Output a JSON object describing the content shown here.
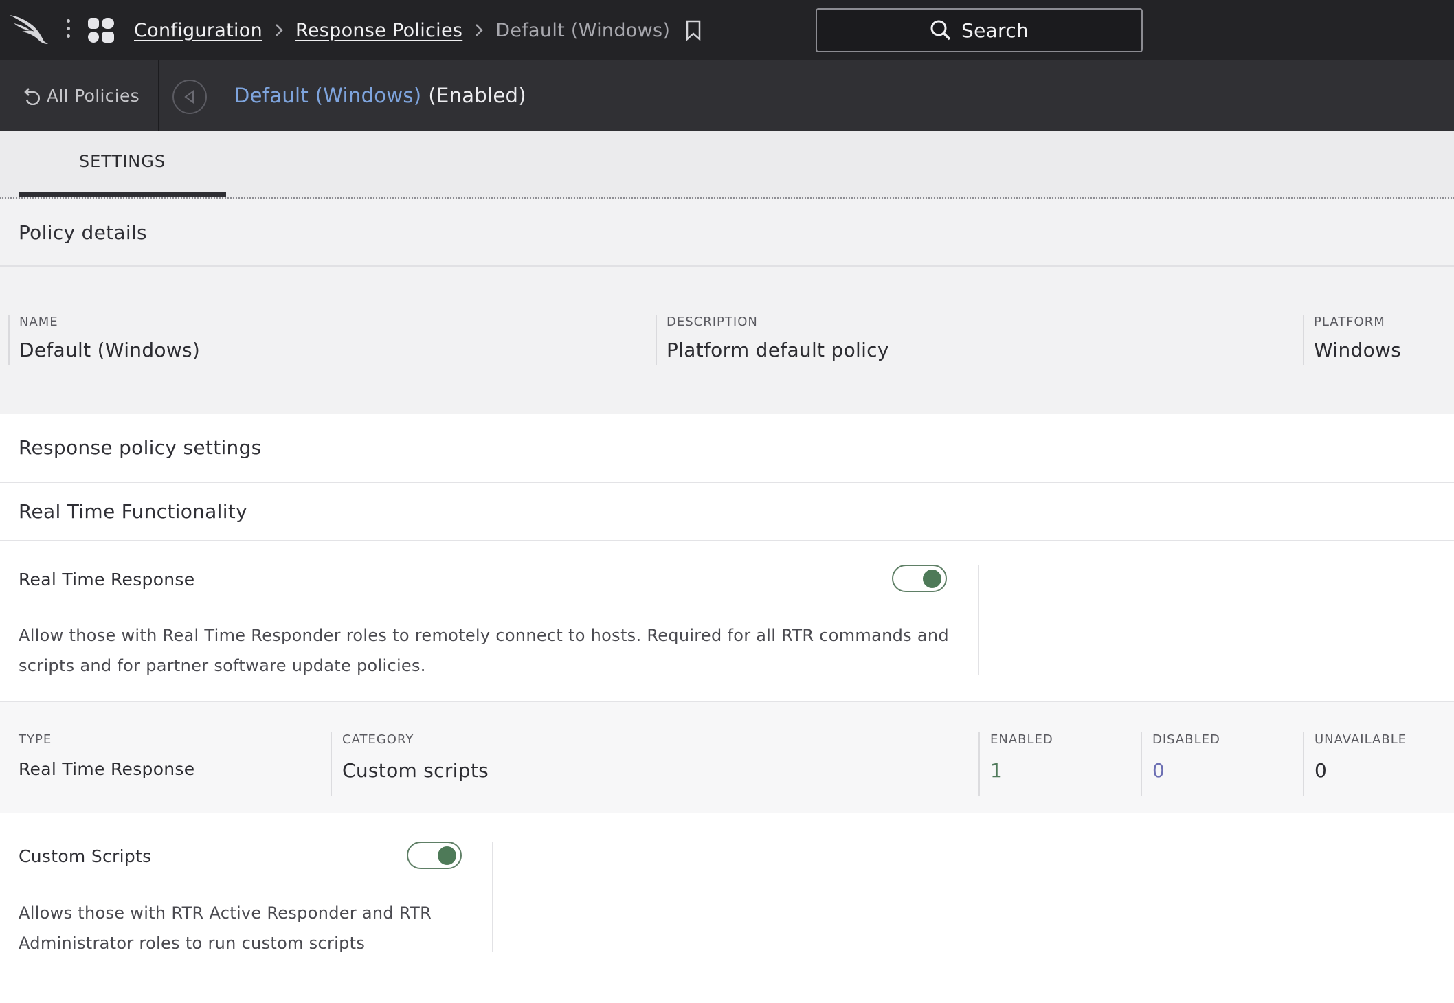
{
  "top_bar": {
    "breadcrumbs": [
      "Configuration",
      "Response Policies"
    ],
    "current": "Default (Windows)",
    "search_label": "Search"
  },
  "sub_bar": {
    "back_label": "All Policies",
    "policy_name": "Default (Windows)",
    "policy_status": "(Enabled)"
  },
  "tabs": {
    "settings": "SETTINGS"
  },
  "policy_details": {
    "heading": "Policy details",
    "name_label": "NAME",
    "name_value": "Default (Windows)",
    "description_label": "DESCRIPTION",
    "description_value": "Platform default policy",
    "platform_label": "PLATFORM",
    "platform_value": "Windows"
  },
  "response_settings": {
    "heading": "Response policy settings",
    "subheading": "Real Time Functionality"
  },
  "real_time_response": {
    "title": "Real Time Response",
    "enabled": true,
    "desc_line1": "Allow those with Real Time Responder roles to remotely connect to hosts. Required for all RTR commands and",
    "desc_line2": "scripts and for partner software update policies."
  },
  "type_row": {
    "type_label": "TYPE",
    "type_value": "Real Time Response",
    "category_label": "CATEGORY",
    "category_value": "Custom scripts",
    "enabled_label": "ENABLED",
    "enabled_value": "1",
    "disabled_label": "DISABLED",
    "disabled_value": "0",
    "unavailable_label": "UNAVAILABLE",
    "unavailable_value": "0"
  },
  "custom_scripts": {
    "title": "Custom Scripts",
    "enabled": true,
    "desc_line1": "Allows those with RTR Active Responder and RTR",
    "desc_line2": "Administrator roles to run custom scripts"
  },
  "colors": {
    "topbar_bg": "#232326",
    "link_blue": "#7ea4dd",
    "toggle_green": "#4e7a58"
  }
}
